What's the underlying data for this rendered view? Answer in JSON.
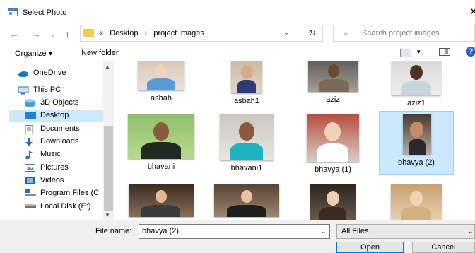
{
  "window": {
    "title": "Select Photo",
    "close_glyph": "✕"
  },
  "address": {
    "prefix": "«",
    "crumbs": [
      "Desktop",
      "project images"
    ],
    "separator": "›"
  },
  "search": {
    "placeholder": "Search project images"
  },
  "toolbar": {
    "organize": "Organize ▾",
    "new_folder": "New folder",
    "help": "?"
  },
  "sidebar": {
    "items": [
      {
        "label": "OneDrive",
        "icon": "cloud-icon"
      },
      {
        "label": "This PC",
        "icon": "monitor-icon"
      },
      {
        "label": "3D Objects",
        "icon": "cube-icon"
      },
      {
        "label": "Desktop",
        "icon": "desktop-icon",
        "selected": true
      },
      {
        "label": "Documents",
        "icon": "document-icon"
      },
      {
        "label": "Downloads",
        "icon": "download-icon"
      },
      {
        "label": "Music",
        "icon": "music-icon"
      },
      {
        "label": "Pictures",
        "icon": "pictures-icon"
      },
      {
        "label": "Videos",
        "icon": "videos-icon"
      },
      {
        "label": "Program Files (C",
        "icon": "drive-icon"
      },
      {
        "label": "Local Disk (E:)",
        "icon": "disk-icon"
      }
    ]
  },
  "files": [
    {
      "name": "asbah"
    },
    {
      "name": "asbah1"
    },
    {
      "name": "aziz"
    },
    {
      "name": "aziz1"
    },
    {
      "name": "bhavani"
    },
    {
      "name": "bhavani1"
    },
    {
      "name": "bhavya (1)"
    },
    {
      "name": "bhavya (2)",
      "selected": true
    },
    {
      "name": ""
    },
    {
      "name": ""
    },
    {
      "name": ""
    },
    {
      "name": ""
    }
  ],
  "footer": {
    "file_name_label": "File name:",
    "file_name_value": "bhavya (2)",
    "filter_value": "All Files",
    "open_label": "Open",
    "cancel_label": "Cancel"
  },
  "colors": {
    "selection": "#cce8ff",
    "accent": "#0078d7",
    "folder": "#f5c94c"
  }
}
